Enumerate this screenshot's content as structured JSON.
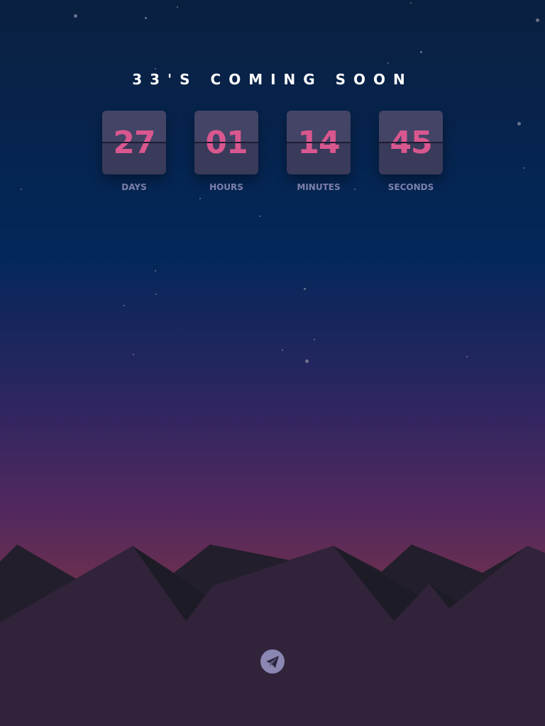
{
  "title": "33'S COMING SOON",
  "countdown": [
    {
      "value": "27",
      "label": "DAYS"
    },
    {
      "value": "01",
      "label": "HOURS"
    },
    {
      "value": "14",
      "label": "MINUTES"
    },
    {
      "value": "45",
      "label": "SECONDS"
    }
  ],
  "social": {
    "icon": "telegram-icon"
  },
  "colors": {
    "digits": "#d9578f",
    "labels": "#8487b3",
    "card_top": "#434466",
    "card_bottom": "#3a3a5a",
    "mountains_front": "#30233a",
    "mountains_back": "#221e2b"
  }
}
